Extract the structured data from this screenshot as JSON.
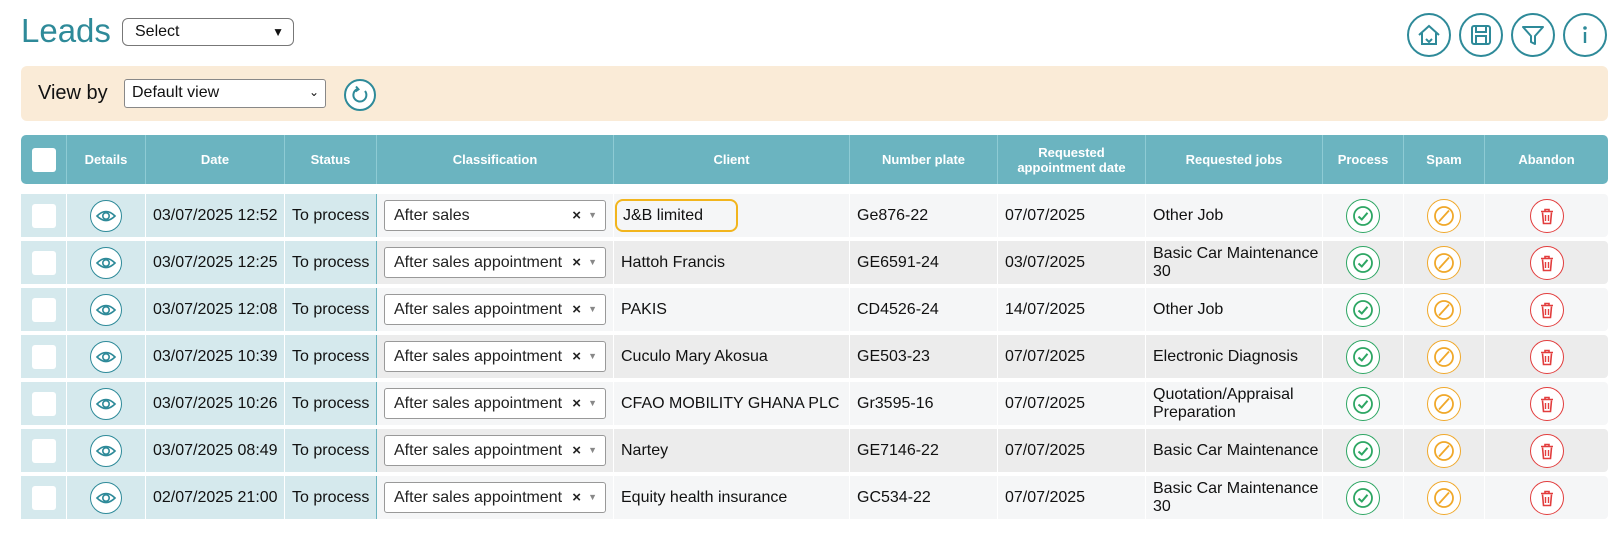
{
  "header": {
    "title": "Leads",
    "select_value": "Select",
    "icons": [
      "home-icon",
      "save-icon",
      "filter-icon",
      "info-icon"
    ]
  },
  "viewbar": {
    "label": "View by",
    "view_value": "Default view"
  },
  "table": {
    "columns": [
      "Details",
      "Date",
      "Status",
      "Classification",
      "Client",
      "Number plate",
      "Requested appointment date",
      "Requested jobs",
      "Process",
      "Spam",
      "Abandon"
    ],
    "rows": [
      {
        "date": "03/07/2025 12:52",
        "status": "To process",
        "classification": "After sales",
        "client": "J&B limited",
        "plate": "Ge876-22",
        "appointment": "07/07/2025",
        "jobs": "Other Job"
      },
      {
        "date": "03/07/2025 12:25",
        "status": "To process",
        "classification": "After sales appointment",
        "client": "Hattoh Francis",
        "plate": "GE6591-24",
        "appointment": "03/07/2025",
        "jobs": "Basic Car Maintenance 30"
      },
      {
        "date": "03/07/2025 12:08",
        "status": "To process",
        "classification": "After sales appointment",
        "client": "PAKIS",
        "plate": "CD4526-24",
        "appointment": "14/07/2025",
        "jobs": "Other Job"
      },
      {
        "date": "03/07/2025 10:39",
        "status": "To process",
        "classification": "After sales appointment",
        "client": "Cuculo Mary Akosua",
        "plate": "GE503-23",
        "appointment": "07/07/2025",
        "jobs": "Electronic Diagnosis"
      },
      {
        "date": "03/07/2025 10:26",
        "status": "To process",
        "classification": "After sales appointment",
        "client": "CFAO MOBILITY GHANA PLC",
        "plate": "Gr3595-16",
        "appointment": "07/07/2025",
        "jobs": "Quotation/Appraisal Preparation"
      },
      {
        "date": "03/07/2025 08:49",
        "status": "To process",
        "classification": "After sales appointment",
        "client": "Nartey",
        "plate": "GE7146-22",
        "appointment": "07/07/2025",
        "jobs": "Basic Car Maintenance"
      },
      {
        "date": "02/07/2025 21:00",
        "status": "To process",
        "classification": "After sales appointment",
        "client": "Equity health insurance",
        "plate": "GC534-22",
        "appointment": "07/07/2025",
        "jobs": "Basic Car Maintenance 30"
      }
    ]
  },
  "colors": {
    "accent": "#2e8a99",
    "header_bg": "#6bb4c0",
    "viewbar_bg": "#faebd7",
    "process": "#2da663",
    "spam": "#f0a82a",
    "abandon": "#e23d3d",
    "highlight": "#f2b51d"
  }
}
